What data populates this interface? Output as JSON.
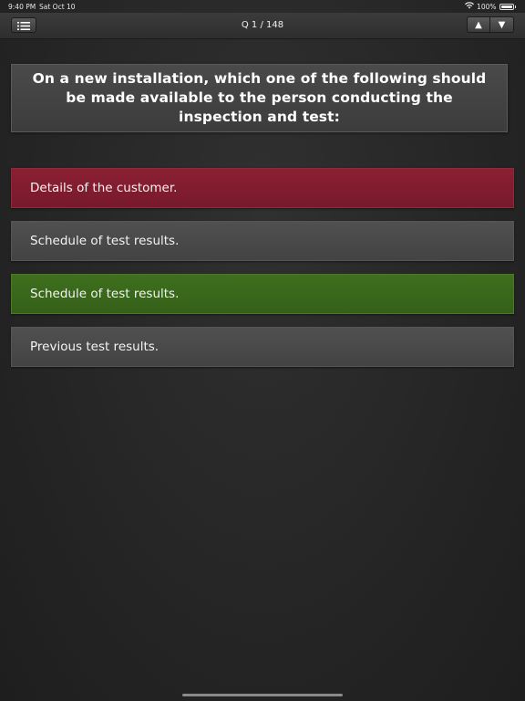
{
  "status_bar": {
    "time": "9:40 PM",
    "date": "Sat Oct 10",
    "battery": "100%"
  },
  "nav": {
    "title": "Q 1 / 148",
    "up_label": "▲",
    "down_label": "▼"
  },
  "question": {
    "text": "On a new installation, which one of the following should be made available to the person conducting the inspection and test:"
  },
  "answers": [
    {
      "text": "Details of the customer.",
      "state": "wrong",
      "color": "#7f1d30"
    },
    {
      "text": "Schedule of test results.",
      "state": "neutral",
      "color": "#484848"
    },
    {
      "text": "Schedule of test results.",
      "state": "correct",
      "color": "#38661a"
    },
    {
      "text": "Previous test results.",
      "state": "neutral",
      "color": "#484848"
    }
  ]
}
